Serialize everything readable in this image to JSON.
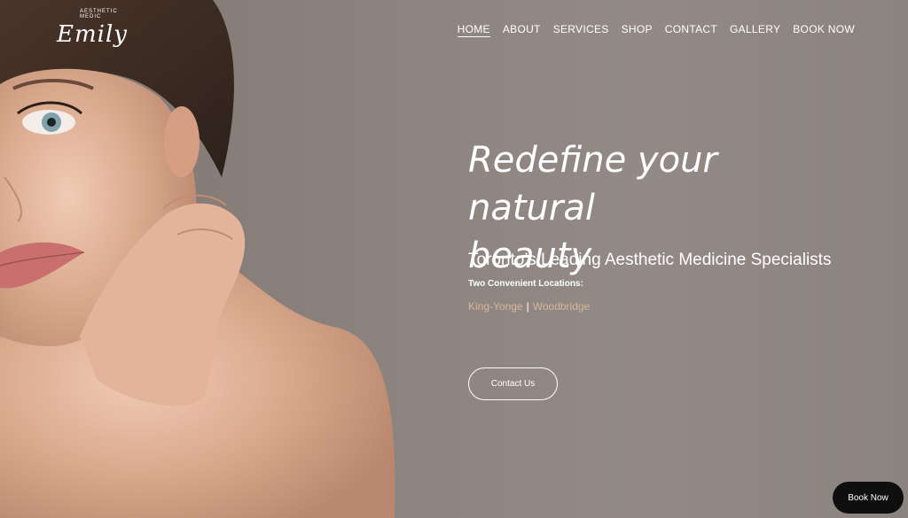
{
  "brand": {
    "logo_script": "Emily",
    "logo_arc_text": "AESTHETIC MEDIC"
  },
  "nav": {
    "items": [
      {
        "label": "HOME",
        "active": true
      },
      {
        "label": "ABOUT",
        "active": false
      },
      {
        "label": "SERVICES",
        "active": false
      },
      {
        "label": "SHOP",
        "active": false
      },
      {
        "label": "CONTACT",
        "active": false
      },
      {
        "label": "GALLERY",
        "active": false
      },
      {
        "label": "BOOK NOW",
        "active": false
      }
    ]
  },
  "hero": {
    "headline_line1": "Redefine your natural",
    "headline_line2": "beauty",
    "subhead": "Toronto’s Leading Aesthetic Medicine Specialists",
    "locations_label": "Two Convenient Locations:",
    "location_1": "King-Yonge",
    "location_separator": "|",
    "location_2": "Woodbridge",
    "cta_label": "Contact Us"
  },
  "floating": {
    "book_now_label": "Book Now"
  },
  "colors": {
    "background": "#8a817c",
    "location_link": "#d7b79a",
    "floating_button": "#0f0f10"
  }
}
